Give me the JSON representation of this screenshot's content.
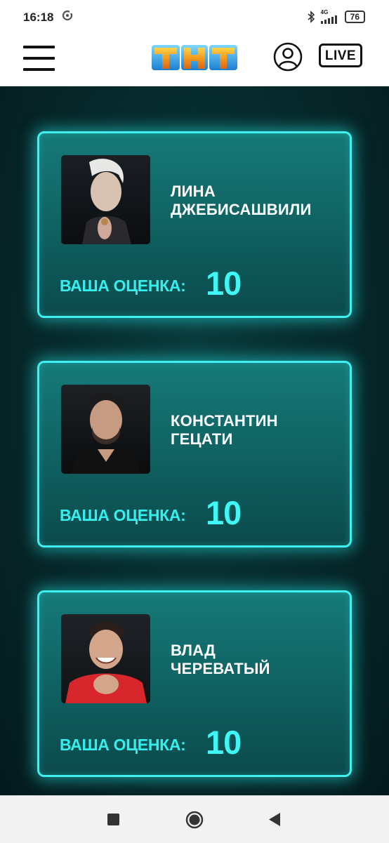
{
  "status_bar": {
    "time": "16:18",
    "network": "4G",
    "battery": "76"
  },
  "header": {
    "logo_text": "ТНТ",
    "live_label": "LIVE"
  },
  "cards": [
    {
      "name_line1": "ЛИНА",
      "name_line2": "ДЖЕБИСАШВИЛИ",
      "score_label": "ВАША ОЦЕНКА:",
      "score": "10"
    },
    {
      "name_line1": "КОНСТАНТИН",
      "name_line2": "ГЕЦАТИ",
      "score_label": "ВАША ОЦЕНКА:",
      "score": "10"
    },
    {
      "name_line1": "ВЛАД",
      "name_line2": "ЧЕРЕВАТЫЙ",
      "score_label": "ВАША ОЦЕНКА:",
      "score": "10"
    }
  ],
  "colors": {
    "accent": "#3ff0ee",
    "card_top": "#157a78",
    "card_bottom": "#0b4a4c",
    "background": "#072c2e"
  }
}
